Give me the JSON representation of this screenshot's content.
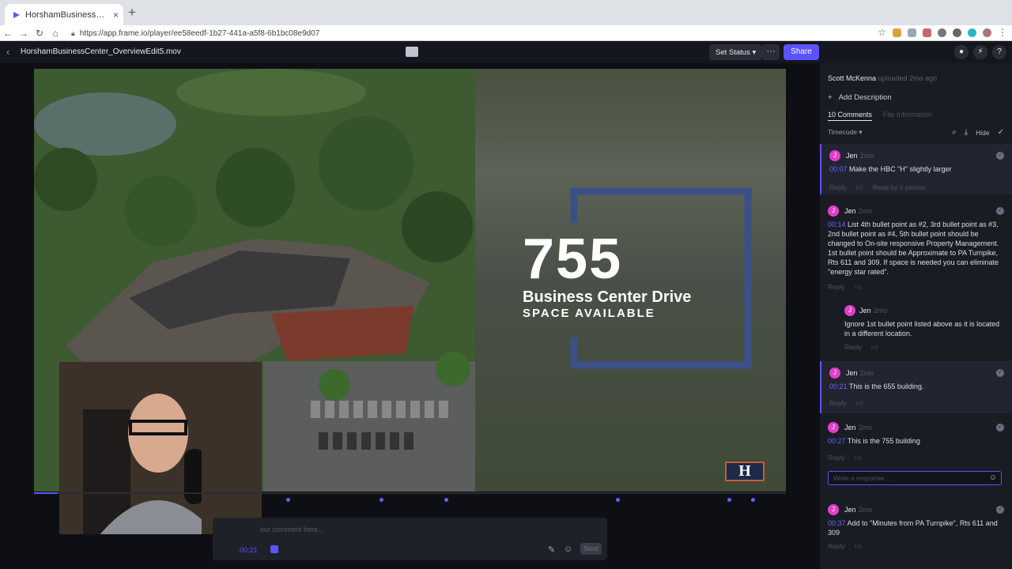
{
  "browser": {
    "tab_title": "HorshamBusinessCenter_Over",
    "tab_close": "×",
    "new_tab": "+",
    "url": "https://app.frame.io/player/ee58eedf-1b27-441a-a5f8-6b1bc08e9d07"
  },
  "app": {
    "file_name": "HorshamBusinessCenter_OverviewEdit5.mov",
    "set_status_label": "Set Status ▾",
    "more_label": "···",
    "share_label": "Share"
  },
  "video": {
    "big_number": "755",
    "title_line": "Business Center Drive",
    "subtitle_line": "SPACE AVAILABLE",
    "logo_letter": "H"
  },
  "composer": {
    "placeholder": "our comment here...",
    "timecode": "00:21",
    "send_label": "Send"
  },
  "panel": {
    "uploader_name": "Scott McKenna",
    "uploader_meta": "uploaded 2mo ago",
    "add_description": "Add Description",
    "tab_comments": "10 Comments",
    "tab_file_info": "File Information",
    "sort_label": "Timecode ▾",
    "hide_label": "Hide",
    "reply_placeholder": "Write a response...",
    "comments": [
      {
        "initial": "J",
        "name": "Jen",
        "age": "2mo",
        "timecode": "00:07",
        "text": "Make the HBC \"H\" slightly larger",
        "reply": "Reply",
        "read": "Read by 1 person"
      },
      {
        "initial": "J",
        "name": "Jen",
        "age": "2mo",
        "timecode": "00:14",
        "text": "List 4th bullet point as #2, 3rd bullet point as #3, 2nd bullet point as #4, 5th bullet point should be changed to On-site responsive Property Management. 1st bullet point should be Approximate to PA Turnpike, Rts 611 and 309. If space is needed you can eliminate \"energy star rated\".",
        "reply": "Reply"
      },
      {
        "initial": "J",
        "name": "Jen",
        "age": "2mo",
        "text": "Ignore 1st bullet point listed above as it is located in a different location.",
        "reply": "Reply"
      },
      {
        "initial": "J",
        "name": "Jen",
        "age": "2mo",
        "timecode": "00:21",
        "text": "This is the 655 building.",
        "reply": "Reply"
      },
      {
        "initial": "J",
        "name": "Jen",
        "age": "2mo",
        "timecode": "00:27",
        "text": "This is the 755 building",
        "reply": "Reply"
      },
      {
        "initial": "J",
        "name": "Jen",
        "age": "2mo",
        "timecode": "00:37",
        "text": "Add to \"Minutes from PA Turnpike\", Rts 611 and 309",
        "reply": "Reply"
      }
    ]
  }
}
